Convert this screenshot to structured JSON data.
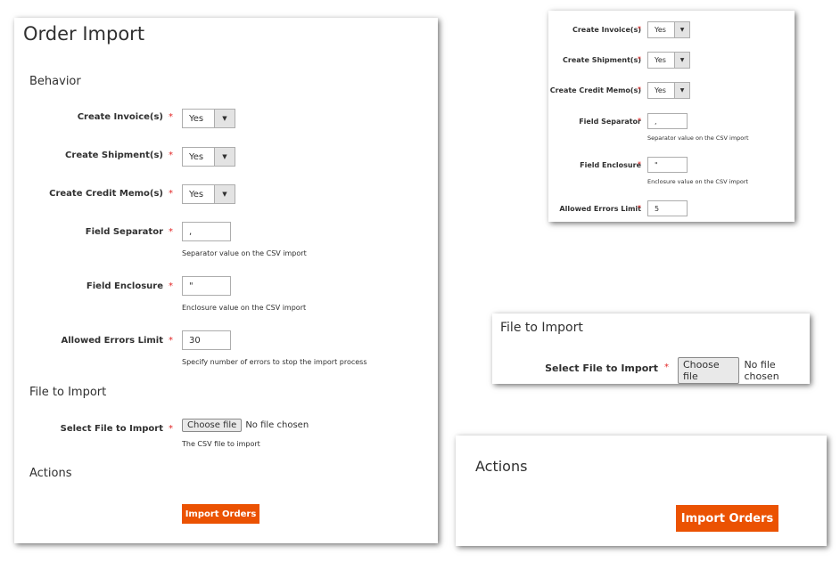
{
  "main": {
    "title": "Order Import",
    "behavior_heading": "Behavior",
    "fields": [
      {
        "label": "Create Invoice(s)",
        "value": "Yes"
      },
      {
        "label": "Create Shipment(s)",
        "value": "Yes"
      },
      {
        "label": "Create Credit Memo(s)",
        "value": "Yes"
      },
      {
        "label": "Field Separator",
        "value": ",",
        "note": "Separator value on the CSV import"
      },
      {
        "label": "Field Enclosure",
        "value": "\"",
        "note": "Enclosure value on the CSV import"
      },
      {
        "label": "Allowed Errors Limit",
        "value": "30",
        "note": "Specify number of errors to stop the import process"
      }
    ],
    "file_heading": "File to Import",
    "file_label": "Select File to Import",
    "choose_file": "Choose file",
    "no_file": "No file chosen",
    "file_note": "The CSV file to import",
    "actions_heading": "Actions",
    "import_button": "Import Orders"
  },
  "zoom_behavior": {
    "fields": [
      {
        "label": "Create Invoice(s)",
        "value": "Yes"
      },
      {
        "label": "Create Shipment(s)",
        "value": "Yes"
      },
      {
        "label": "Create Credit Memo(s)",
        "value": "Yes"
      },
      {
        "label": "Field Separator",
        "value": ",",
        "note": "Separator value on the CSV import"
      },
      {
        "label": "Field Enclosure",
        "value": "\"",
        "note": "Enclosure value on the CSV import"
      },
      {
        "label": "Allowed Errors Limit",
        "value": "5"
      }
    ]
  },
  "zoom_file": {
    "heading": "File to Import",
    "label": "Select File to Import",
    "choose_file": "Choose file",
    "no_file": "No file chosen"
  },
  "zoom_actions": {
    "heading": "Actions",
    "import_button": "Import Orders"
  },
  "colors": {
    "accent": "#eb5202",
    "required": "#e22626"
  }
}
